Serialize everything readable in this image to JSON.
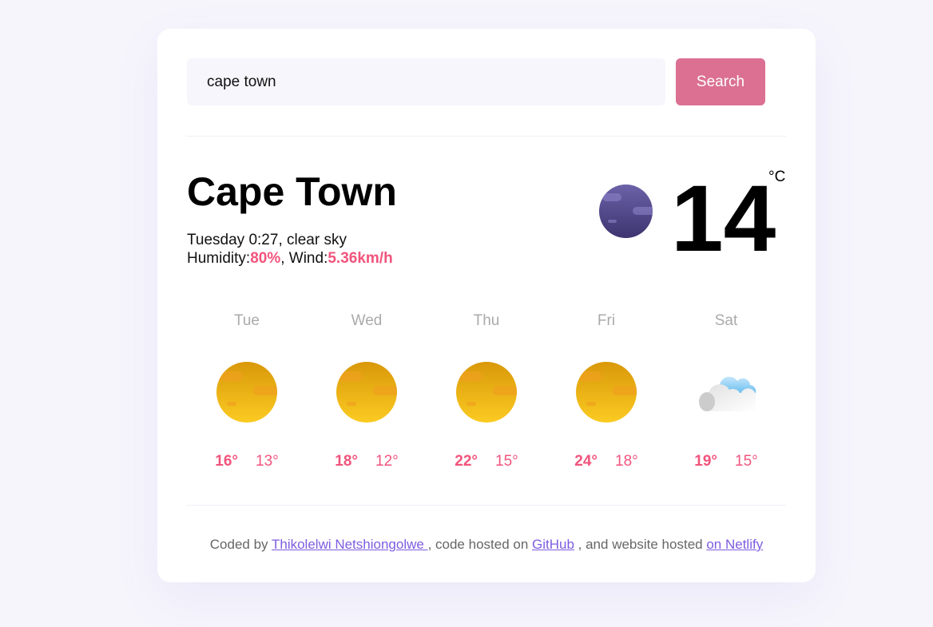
{
  "search": {
    "value": "cape town",
    "button": "Search"
  },
  "current": {
    "city": "Cape Town",
    "datetime": "Tuesday 0:27",
    "description": "clear sky",
    "humidity_label": "Humidity:",
    "humidity": "80%",
    "wind_label": "Wind:",
    "wind": "5.36km/h",
    "temperature": "14",
    "unit": "°C",
    "icon": "moon-clear-night-icon"
  },
  "forecast": [
    {
      "day": "Tue",
      "max": "16°",
      "min": "13°",
      "icon": "sun-icon"
    },
    {
      "day": "Wed",
      "max": "18°",
      "min": "12°",
      "icon": "sun-icon"
    },
    {
      "day": "Thu",
      "max": "22°",
      "min": "15°",
      "icon": "sun-icon"
    },
    {
      "day": "Fri",
      "max": "24°",
      "min": "18°",
      "icon": "sun-icon"
    },
    {
      "day": "Sat",
      "max": "19°",
      "min": "15°",
      "icon": "cloud-icon"
    }
  ],
  "footer": {
    "t1": "Coded by ",
    "author": "Thikolelwi Netshiongolwe ",
    "t2": ", code hosted on ",
    "github": "GitHub",
    "t3": " , and website hosted ",
    "netlify": "on Netlify"
  },
  "colors": {
    "accent": "#db7093",
    "highlight": "#f2547c",
    "link": "#7d5ce0"
  }
}
